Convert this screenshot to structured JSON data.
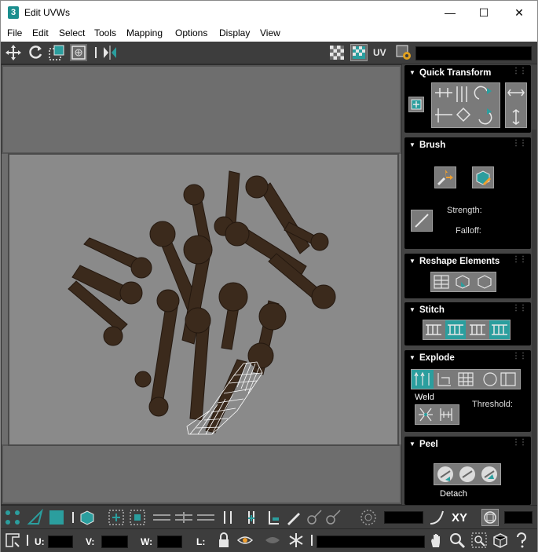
{
  "window": {
    "title": "Edit UVWs",
    "app_badge": "3"
  },
  "window_controls": {
    "minimize": "—",
    "maximize": "☐",
    "close": "✕"
  },
  "menu": [
    "File",
    "Edit",
    "Select",
    "Tools",
    "Mapping",
    "Options",
    "Display",
    "View"
  ],
  "toolbar": {
    "uv_label": "UV"
  },
  "panels": {
    "quick_transform": "Quick Transform",
    "brush": "Brush",
    "strength_label": "Strength:",
    "falloff_label": "Falloff:",
    "reshape": "Reshape Elements",
    "stitch": "Stitch",
    "explode": "Explode",
    "weld_label": "Weld",
    "threshold_label": "Threshold:",
    "peel": "Peel",
    "detach_label": "Detach"
  },
  "bottom": {
    "xy_label": "XY",
    "u_label": "U:",
    "v_label": "V:",
    "w_label": "W:",
    "l_label": "L:"
  },
  "colors": {
    "accent_teal": "#2b9e9e",
    "panel_black": "#000000",
    "ui_gray": "#444444"
  }
}
